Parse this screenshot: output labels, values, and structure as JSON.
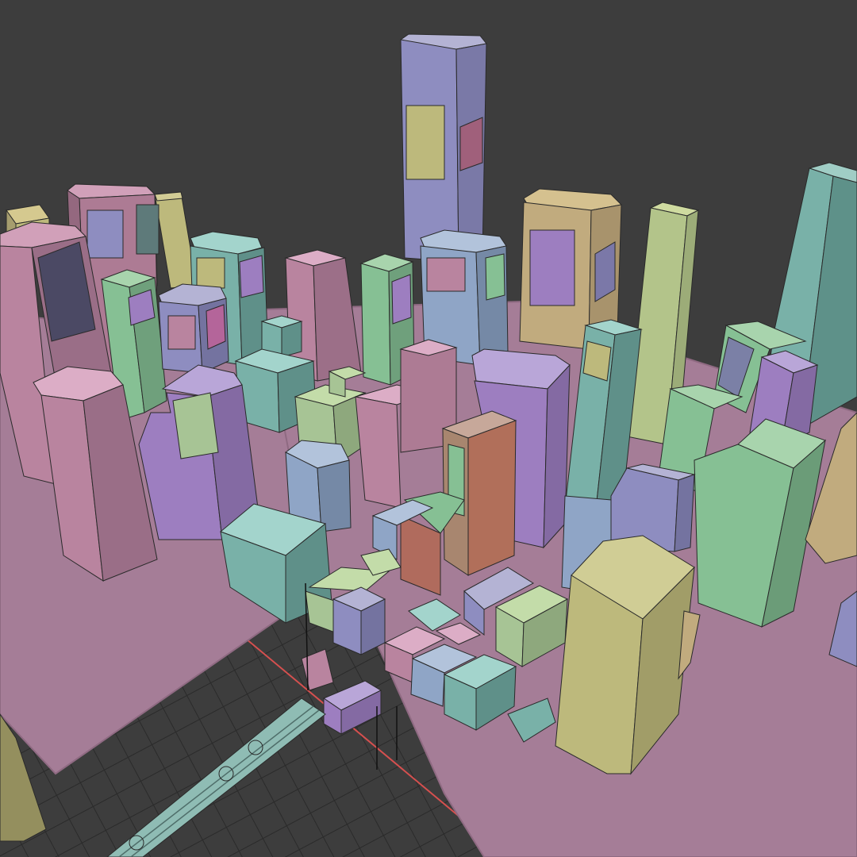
{
  "viewport": {
    "shading": "solid",
    "object_color_mode": "random",
    "background_color": "#3d3d3d",
    "grid_color": "#2a2a2a",
    "x_axis_color": "#d6504f",
    "ground_color": "#a57d97"
  },
  "palette": {
    "pink": "#b9849f",
    "teal": "#79b1b1",
    "green": "#86c094",
    "lavender": "#8e8dc0",
    "purple": "#9d7ec0",
    "olive": "#bdb97c",
    "tan": "#c1ab7e",
    "lilac": "#b48bb9",
    "blue": "#8fa5c6",
    "pale_green": "#a7c495"
  }
}
